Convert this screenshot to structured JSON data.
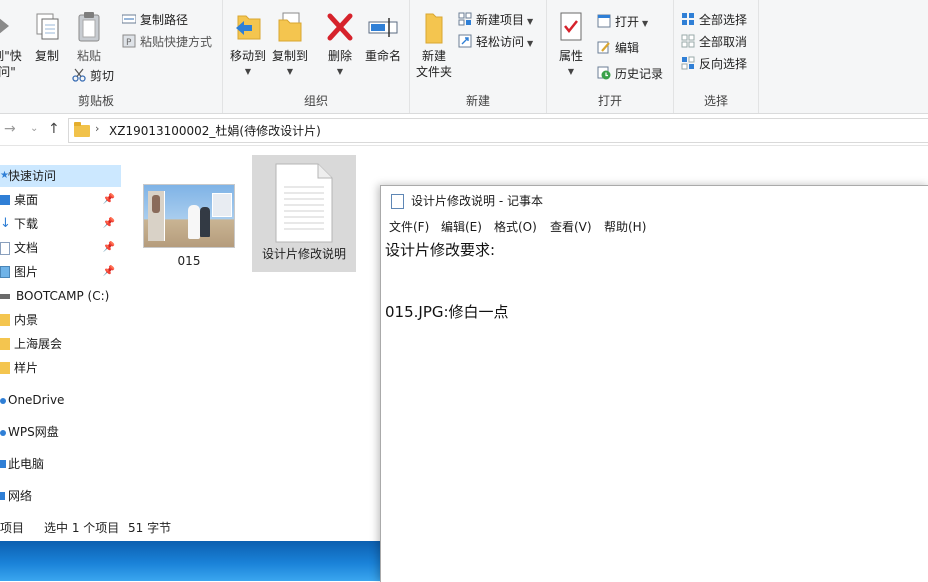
{
  "ribbon": {
    "clipboard": {
      "pin_label_1": "到\"快",
      "pin_label_2": "问\"",
      "copy": "复制",
      "paste": "粘贴",
      "copy_path": "复制路径",
      "paste_shortcut": "粘贴快捷方式",
      "cut": "剪切",
      "group": "剪贴板"
    },
    "organize": {
      "move_to": "移动到",
      "copy_to": "复制到",
      "delete": "删除",
      "rename": "重命名",
      "group": "组织"
    },
    "new": {
      "new_folder_1": "新建",
      "new_folder_2": "文件夹",
      "new_item": "新建项目",
      "easy_access": "轻松访问",
      "group": "新建"
    },
    "open": {
      "properties": "属性",
      "open": "打开",
      "edit": "编辑",
      "history": "历史记录",
      "group": "打开"
    },
    "select": {
      "select_all": "全部选择",
      "select_none": "全部取消",
      "invert": "反向选择",
      "group": "选择"
    }
  },
  "address": {
    "path": "XZ19013100002_杜娟(待修改设计片)"
  },
  "nav": {
    "items": [
      {
        "label": "快速访问"
      },
      {
        "label": "桌面"
      },
      {
        "label": "下载"
      },
      {
        "label": "文档"
      },
      {
        "label": "图片"
      },
      {
        "label": "BOOTCAMP (C:)"
      },
      {
        "label": "内景"
      },
      {
        "label": "上海展会"
      },
      {
        "label": "样片"
      },
      {
        "label": "OneDrive"
      },
      {
        "label": "WPS网盘"
      },
      {
        "label": "此电脑"
      },
      {
        "label": "网络"
      }
    ]
  },
  "files": [
    {
      "name": "015"
    },
    {
      "name": "设计片修改说明"
    }
  ],
  "status": {
    "items": "项目",
    "selected": "选中 1 个项目",
    "size": "51 字节"
  },
  "notepad": {
    "title": "设计片修改说明 - 记事本",
    "menu": [
      "文件(F)",
      "编辑(E)",
      "格式(O)",
      "查看(V)",
      "帮助(H)"
    ],
    "line1": "设计片修改要求:",
    "line2": "015.JPG:修白一点"
  }
}
